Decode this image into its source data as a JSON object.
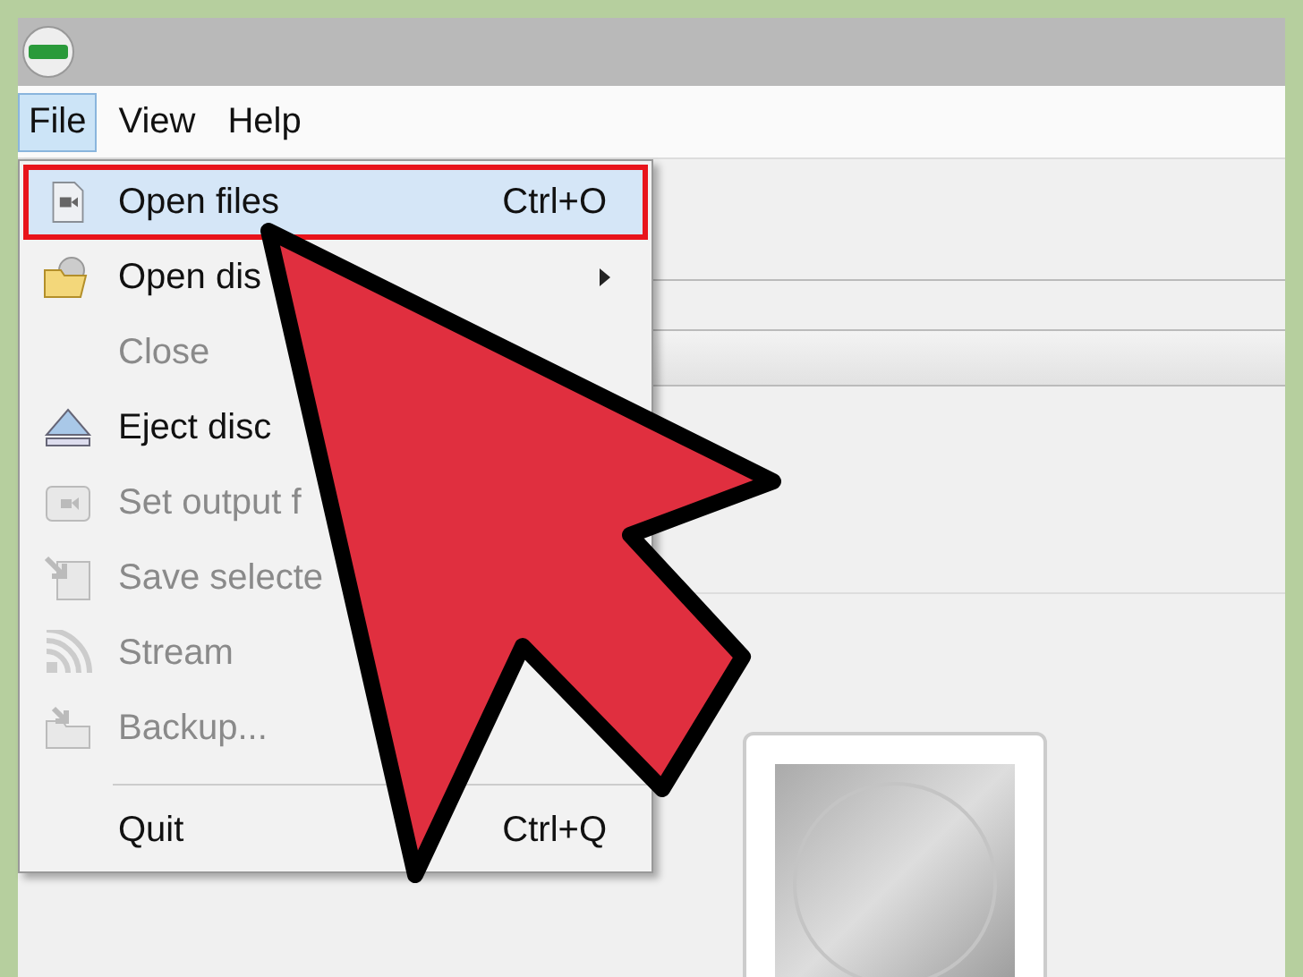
{
  "menu_bar": [
    {
      "label": "File",
      "selected": true
    },
    {
      "label": "View",
      "selected": false
    },
    {
      "label": "Help",
      "selected": false
    }
  ],
  "file_menu": [
    {
      "label": "Open files",
      "shortcut": "Ctrl+O",
      "kind": "video",
      "selected": true,
      "callout": true,
      "disabled": false
    },
    {
      "label": "Open dis",
      "kind": "folder",
      "selected": false,
      "callout": false,
      "disabled": false,
      "submenu": true
    },
    {
      "label": "Close",
      "kind": "none",
      "selected": false,
      "callout": false,
      "disabled": true
    },
    {
      "label": "Eject disc",
      "kind": "eject",
      "selected": false,
      "callout": false,
      "disabled": false
    },
    {
      "label": "Set output f",
      "kind": "video-folder",
      "selected": false,
      "callout": false,
      "disabled": true
    },
    {
      "label": "Save selecte",
      "kind": "save",
      "selected": false,
      "callout": false,
      "disabled": true
    },
    {
      "label": "Stream",
      "kind": "stream",
      "selected": false,
      "callout": false,
      "disabled": true
    },
    {
      "label": "Backup...",
      "kind": "backup",
      "selected": false,
      "callout": false,
      "disabled": true
    },
    {
      "kind": "separator"
    },
    {
      "label": "Quit",
      "shortcut": "Ctrl+Q",
      "kind": "none",
      "selected": false,
      "callout": false,
      "disabled": false
    }
  ]
}
